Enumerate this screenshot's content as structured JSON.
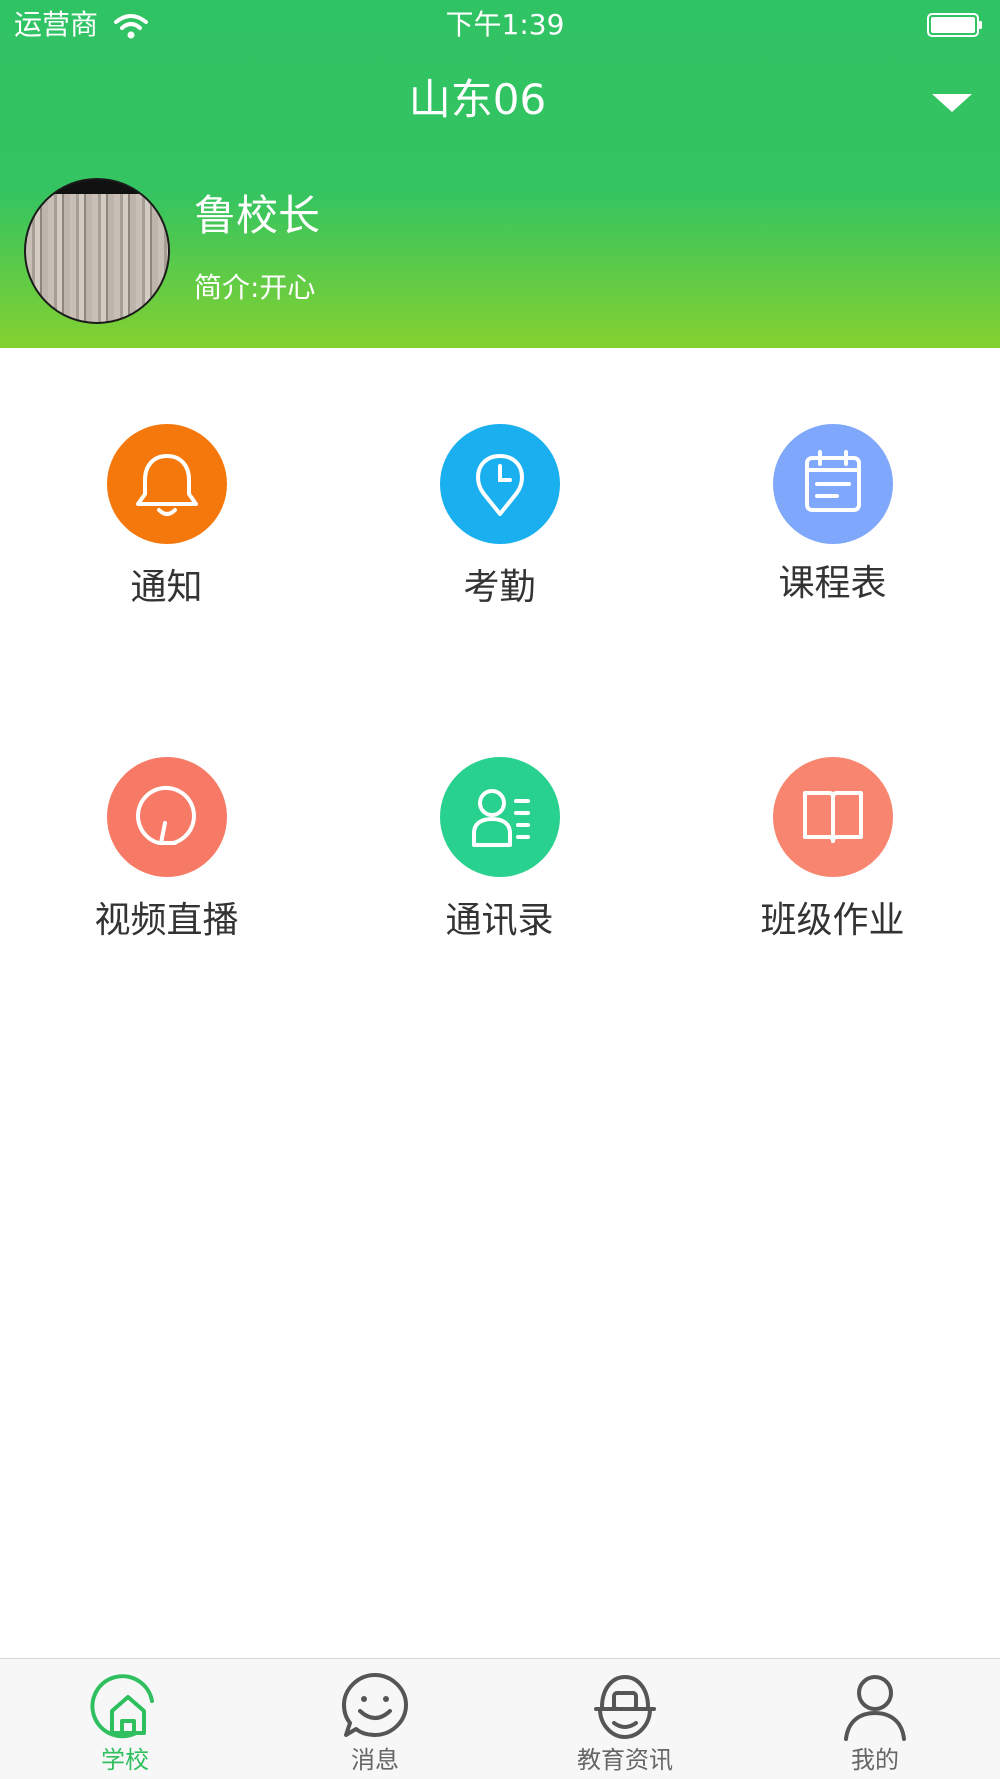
{
  "status_bar": {
    "carrier": "运营商",
    "time": "下午1:39"
  },
  "header": {
    "title": "山东06"
  },
  "profile": {
    "name": "鲁校长",
    "bio": "简介:开心"
  },
  "colors": {
    "header_top": "#30c364",
    "header_bottom": "#84d130",
    "active_tab": "#2fbf5f"
  },
  "grid": [
    {
      "label": "通知",
      "icon": "bell-icon",
      "color": "#f5780d"
    },
    {
      "label": "考勤",
      "icon": "location-clock-icon",
      "color": "#1ab0ef"
    },
    {
      "label": "课程表",
      "icon": "calendar-icon",
      "color": "#7fa7fb"
    },
    {
      "label": "视频直播",
      "icon": "live-video-icon",
      "color": "#f77a66"
    },
    {
      "label": "通讯录",
      "icon": "contacts-icon",
      "color": "#29d18e"
    },
    {
      "label": "班级作业",
      "icon": "book-icon",
      "color": "#f88570"
    }
  ],
  "tabs": [
    {
      "label": "学校",
      "icon": "school-home-icon",
      "active": true
    },
    {
      "label": "消息",
      "icon": "smile-chat-icon",
      "active": false
    },
    {
      "label": "教育资讯",
      "icon": "news-face-icon",
      "active": false
    },
    {
      "label": "我的",
      "icon": "user-icon",
      "active": false
    }
  ]
}
